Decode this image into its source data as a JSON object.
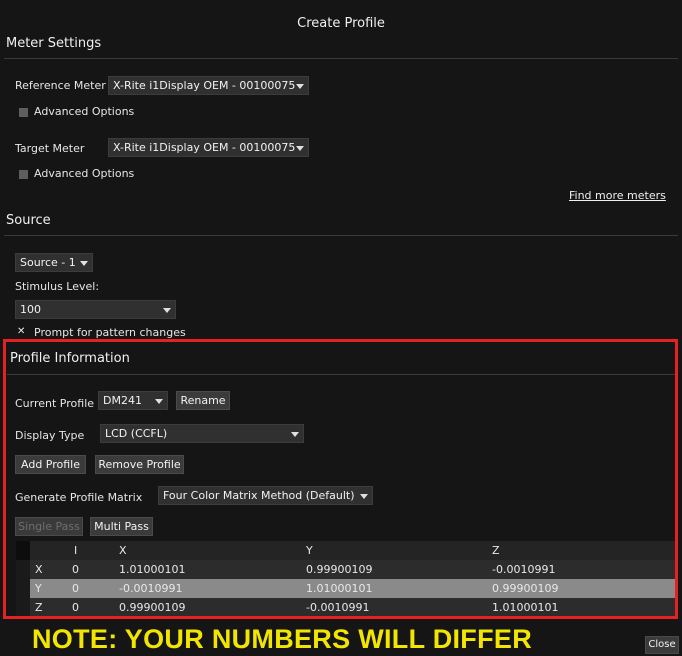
{
  "window": {
    "title": "Create Profile"
  },
  "meter_settings": {
    "heading": "Meter Settings",
    "reference_label": "Reference Meter",
    "reference_value": "X-Rite i1Display OEM - 00100075",
    "reference_advanced": "Advanced Options",
    "target_label": "Target Meter",
    "target_value": "X-Rite i1Display OEM - 00100075",
    "target_advanced": "Advanced Options",
    "find_more": "Find more meters"
  },
  "source": {
    "heading": "Source",
    "source_value": "Source - 1",
    "stimulus_label": "Stimulus Level:",
    "stimulus_value": "100",
    "prompt_label": "Prompt for pattern changes",
    "prompt_checked": true
  },
  "profile_info": {
    "heading": "Profile Information",
    "current_label": "Current Profile",
    "current_value": "DM241",
    "rename_label": "Rename",
    "display_type_label": "Display Type",
    "display_type_value": "LCD (CCFL)",
    "add_label": "Add Profile",
    "remove_label": "Remove Profile",
    "matrix_label": "Generate Profile Matrix",
    "matrix_value": "Four Color Matrix Method (Default)",
    "single_pass_label": "Single Pass",
    "multi_pass_label": "Multi Pass"
  },
  "matrix": {
    "headers": [
      "I",
      "X",
      "Y",
      "Z"
    ],
    "rows": [
      {
        "name": "X",
        "i": "0",
        "x": "1.01000101",
        "y": "0.99900109",
        "z": "-0.0010991"
      },
      {
        "name": "Y",
        "i": "0",
        "x": "-0.0010991",
        "y": "1.01000101",
        "z": "0.99900109"
      },
      {
        "name": "Z",
        "i": "0",
        "x": "0.99900109",
        "y": "-0.0010991",
        "z": "1.01000101"
      }
    ]
  },
  "note": "NOTE: YOUR NUMBERS WILL DIFFER",
  "close_label": "Close",
  "colors": {
    "highlight": "#e52222",
    "note": "#f2e600",
    "selected_row": "#8a8a8a"
  }
}
